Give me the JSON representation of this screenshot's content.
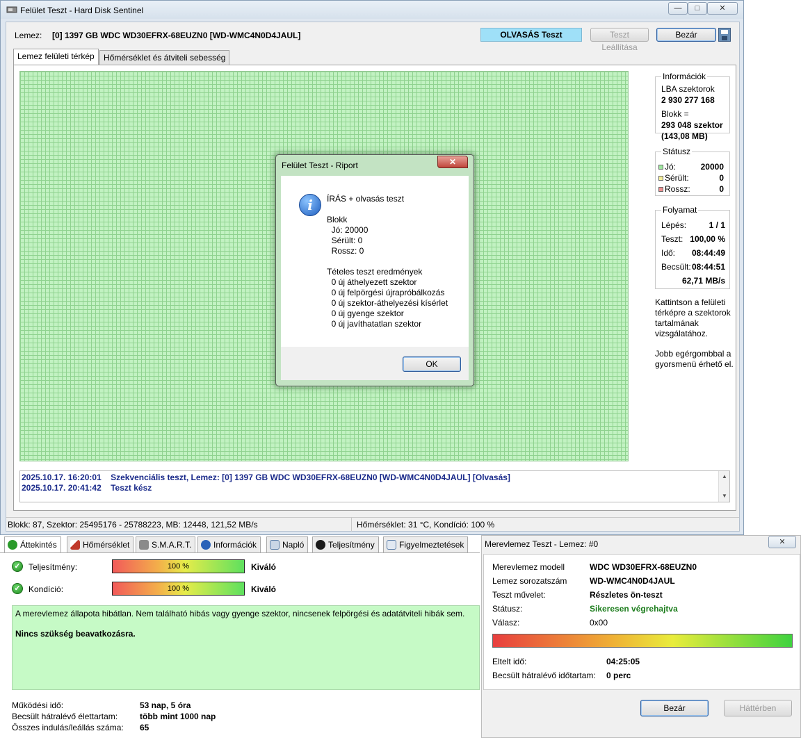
{
  "window": {
    "title": "Felület Teszt - Hard Disk Sentinel",
    "minimize_glyph": "—",
    "maximize_glyph": "□",
    "close_glyph": "✕"
  },
  "toolbar": {
    "disk_label": "Lemez:",
    "disk_name": "[0] 1397 GB  WDC WD30EFRX-68EUZN0 [WD-WMC4N0D4JAUL]",
    "status": "OLVASÁS Teszt",
    "stop_label": "Teszt Leállítása",
    "close_label": "Bezár"
  },
  "tabs": [
    {
      "label": "Lemez felületi térkép"
    },
    {
      "label": "Hőmérséklet és átviteli sebesség"
    }
  ],
  "info_panel": {
    "info": {
      "heading": "Információk",
      "lba_label": "LBA szektorok",
      "lba_value": "2 930 277 168",
      "block_label": "Blokk =",
      "block_value": "293 048 szektor",
      "block_size": "(143,08 MB)"
    },
    "status": {
      "heading": "Státusz",
      "good_label": "Jó:",
      "good_value": "20000",
      "damaged_label": "Sérült:",
      "damaged_value": "0",
      "bad_label": "Rossz:",
      "bad_value": "0"
    },
    "progress": {
      "heading": "Folyamat",
      "step_label": "Lépés:",
      "step_value": "1 / 1",
      "test_label": "Teszt:",
      "test_value": "100,00 %",
      "time_label": "Idő:",
      "time_value": "08:44:49",
      "est_label": "Becsült:",
      "est_value": "08:44:51",
      "speed": "62,71 MB/s"
    },
    "hint1": "Kattintson a felületi térképre a szektorok tartalmának vizsgálatához.",
    "hint2": "Jobb egérgombbal a gyorsmenü érhető el."
  },
  "log": {
    "lines": [
      {
        "time": "2025.10.17.  16:20:01",
        "text": "Szekvenciális teszt, Lemez: [0] 1397 GB  WDC WD30EFRX-68EUZN0 [WD-WMC4N0D4JAUL] [Olvasás]"
      },
      {
        "time": "2025.10.17.  20:41:42",
        "text": "Teszt kész"
      }
    ]
  },
  "statusbar": {
    "left": "Blokk: 87, Szektor: 25495176 - 25788223, MB: 12448, 121,52 MB/s",
    "right": "Hőmérséklet: 31  °C,  Kondíció: 100 %"
  },
  "dialog": {
    "title": "Felület Teszt - Riport",
    "close_glyph": "✕",
    "icon": "info-icon",
    "text": "ÍRÁS + olvasás teszt\n\nBlokk\n  Jó: 20000\n  Sérült: 0\n  Rossz: 0\n\nTételes teszt eredmények\n  0 új áthelyezett szektor\n  0 új felpörgési újrapróbálkozás\n  0 új szektor-áthelyezési kísérlet\n  0 új gyenge szektor\n  0 új javíthatatlan szektor",
    "ok_label": "OK"
  },
  "bottom": {
    "tabs": [
      {
        "label": "Áttekintés",
        "icon": "check-icon",
        "color": "#2a9a2a"
      },
      {
        "label": "Hőmérséklet",
        "icon": "thermometer-icon",
        "color": "#c0392b"
      },
      {
        "label": "S.M.A.R.T.",
        "icon": "smart-icon",
        "color": "#7a7a7a"
      },
      {
        "label": "Információk",
        "icon": "info-icon",
        "color": "#2a62b8"
      },
      {
        "label": "Napló",
        "icon": "log-icon",
        "color": "#5a7da8"
      },
      {
        "label": "Teljesítmény",
        "icon": "gauge-icon",
        "color": "#1a1a1a"
      },
      {
        "label": "Figyelmeztetések",
        "icon": "alert-icon",
        "color": "#5a7da8"
      }
    ],
    "performance_label": "Teljesítmény:",
    "performance_value": "100 %",
    "performance_level": 1.0,
    "performance_rating": "Kiváló",
    "condition_label": "Kondíció:",
    "condition_value": "100 %",
    "condition_level": 1.0,
    "condition_rating": "Kiváló",
    "summary": "A merevlemez állapota hibátlan. Nem található hibás vagy gyenge szektor, nincsenek felpörgési és adatátviteli hibák sem.",
    "action": "Nincs szükség beavatkozásra.",
    "uptime_label": "Működési idő:",
    "uptime_value": "53 nap, 5 óra",
    "lifetime_label": "Becsült hátralévő élettartam:",
    "lifetime_value": "több mint 1000 nap",
    "starts_label": "Összes indulás/leállás száma:",
    "starts_value": "65"
  },
  "test_window": {
    "title": "Merevlemez Teszt - Lemez: #0",
    "close_glyph": "✕",
    "model_label": "Merevlemez modell",
    "model_value": "WDC WD30EFRX-68EUZN0",
    "serial_label": "Lemez sorozatszám",
    "serial_value": "WD-WMC4N0D4JAUL",
    "op_label": "Teszt művelet:",
    "op_value": "Részletes ön-teszt",
    "status_label": "Státusz:",
    "status_value": "Sikeresen végrehajtva",
    "reply_label": "Válasz:",
    "reply_value": "0x00",
    "progress_level": 1.0,
    "elapsed_label": "Eltelt idő:",
    "elapsed_value": "04:25:05",
    "remaining_label": "Becsült hátralévő időtartam:",
    "remaining_value": "0 perc",
    "close_label": "Bezár",
    "background_label": "Háttérben"
  },
  "colors": {
    "map_good": "#c2f2c2",
    "status_ok": "#1d7d1d",
    "log_text": "#1a2a8a",
    "summary_bg": "#c6fac6"
  }
}
